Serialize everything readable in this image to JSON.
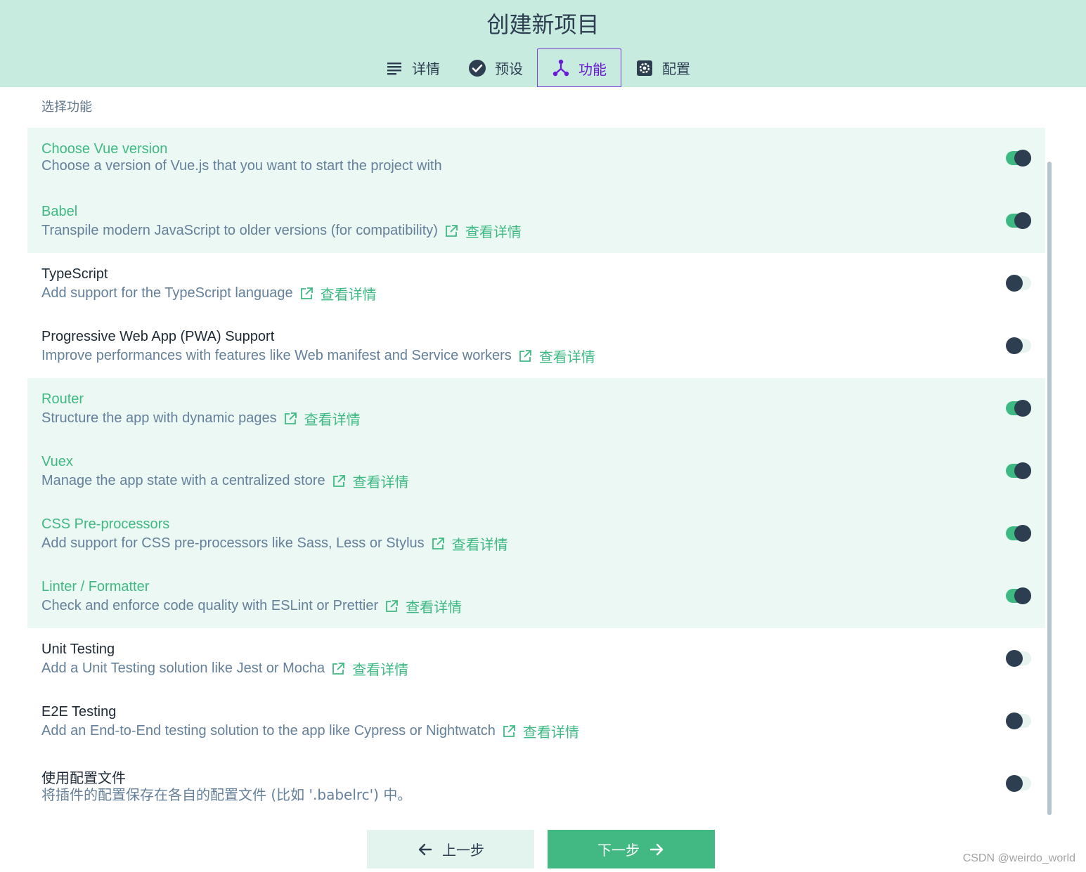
{
  "header": {
    "title": "创建新项目",
    "tabs": [
      {
        "label": "详情",
        "icon": "list-icon",
        "active": false
      },
      {
        "label": "预设",
        "icon": "check-circle-icon",
        "active": false
      },
      {
        "label": "功能",
        "icon": "fork-icon",
        "active": true
      },
      {
        "label": "配置",
        "icon": "gear-icon",
        "active": false
      }
    ]
  },
  "section_label": "选择功能",
  "more_link": "查看详情",
  "features": [
    {
      "name": "Choose Vue version",
      "desc": "Choose a version of Vue.js that you want to start the project with",
      "enabled": true,
      "has_link": false
    },
    {
      "name": "Babel",
      "desc": "Transpile modern JavaScript to older versions (for compatibility)",
      "enabled": true,
      "has_link": true
    },
    {
      "name": "TypeScript",
      "desc": "Add support for the TypeScript language",
      "enabled": false,
      "has_link": true
    },
    {
      "name": "Progressive Web App (PWA) Support",
      "desc": "Improve performances with features like Web manifest and Service workers",
      "enabled": false,
      "has_link": true
    },
    {
      "name": "Router",
      "desc": "Structure the app with dynamic pages",
      "enabled": true,
      "has_link": true
    },
    {
      "name": "Vuex",
      "desc": "Manage the app state with a centralized store",
      "enabled": true,
      "has_link": true
    },
    {
      "name": "CSS Pre-processors",
      "desc": "Add support for CSS pre-processors like Sass, Less or Stylus",
      "enabled": true,
      "has_link": true
    },
    {
      "name": "Linter / Formatter",
      "desc": "Check and enforce code quality with ESLint or Prettier",
      "enabled": true,
      "has_link": true
    },
    {
      "name": "Unit Testing",
      "desc": "Add a Unit Testing solution like Jest or Mocha",
      "enabled": false,
      "has_link": true
    },
    {
      "name": "E2E Testing",
      "desc": "Add an End-to-End testing solution to the app like Cypress or Nightwatch",
      "enabled": false,
      "has_link": true
    },
    {
      "name": "使用配置文件",
      "desc": "将插件的配置保存在各自的配置文件 (比如 '.babelrc') 中。",
      "enabled": false,
      "has_link": false
    }
  ],
  "footer": {
    "prev_label": "上一步",
    "next_label": "下一步"
  },
  "watermark": "CSDN @weirdo_world",
  "colors": {
    "header_bg": "#c7ebdf",
    "accent": "#42b983",
    "active_tab": "#6a1bd4",
    "row_on_bg": "#ecf8f4",
    "knob": "#2c3e50"
  }
}
